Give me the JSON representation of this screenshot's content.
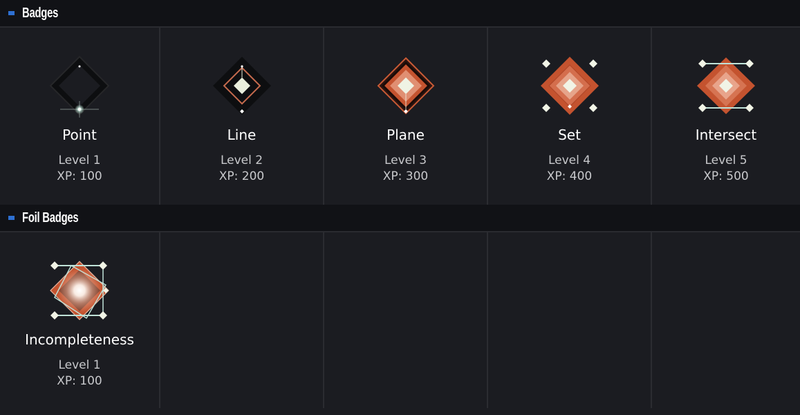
{
  "sections": [
    {
      "title": "Badges",
      "badges": [
        {
          "name": "Point",
          "level": "Level 1",
          "xp": "XP: 100",
          "icon": "badge-point-icon"
        },
        {
          "name": "Line",
          "level": "Level 2",
          "xp": "XP: 200",
          "icon": "badge-line-icon"
        },
        {
          "name": "Plane",
          "level": "Level 3",
          "xp": "XP: 300",
          "icon": "badge-plane-icon"
        },
        {
          "name": "Set",
          "level": "Level 4",
          "xp": "XP: 400",
          "icon": "badge-set-icon"
        },
        {
          "name": "Intersect",
          "level": "Level 5",
          "xp": "XP: 500",
          "icon": "badge-intersect-icon"
        }
      ]
    },
    {
      "title": "Foil Badges",
      "badges": [
        {
          "name": "Incompleteness",
          "level": "Level 1",
          "xp": "XP: 100",
          "icon": "badge-incompleteness-foil-icon"
        }
      ]
    }
  ],
  "colors": {
    "background": "#1b1c21",
    "header_background": "#111216",
    "header_marker": "#2d6fd1",
    "grid_line": "#2b2c31",
    "badge_orange": "#c95a35",
    "badge_core": "#e8eedd"
  }
}
